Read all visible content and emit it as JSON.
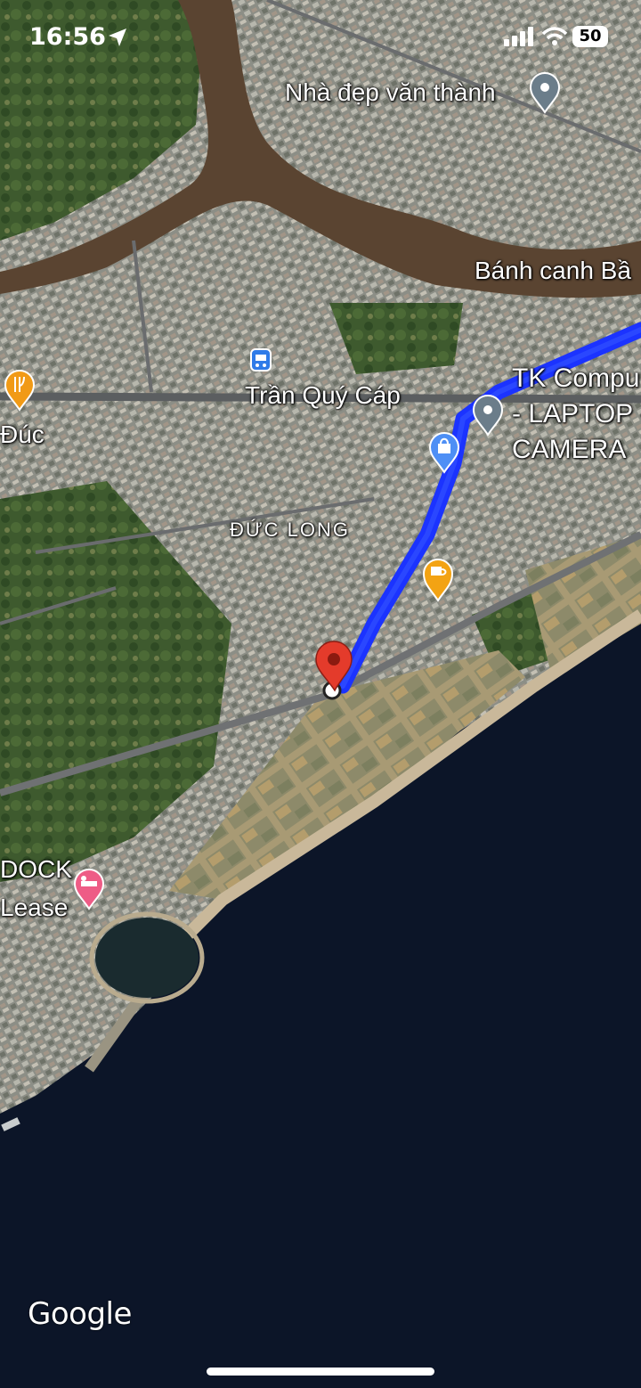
{
  "status_bar": {
    "time": "16:56",
    "battery": "50",
    "icons": [
      "location-arrow-icon",
      "signal-icon",
      "wifi-icon",
      "battery-icon"
    ]
  },
  "map": {
    "type": "satellite",
    "route_color": "#1a3cff",
    "labels": {
      "place_1": "Nhà đẹp văn thành",
      "place_2": "Bánh canh Bầ",
      "street_1": "Trần Quý Cáp",
      "shop_line_1": "TK Compu",
      "shop_line_2": "- LAPTOP -",
      "shop_line_3": "CAMERA",
      "district": "ĐỨC LONG",
      "partial_left": "Đúc",
      "hotel_line_1": "DOCK",
      "hotel_line_2": "Lease"
    },
    "markers": [
      "destination-pin-icon",
      "restaurant-pin-icon",
      "bus-stop-icon",
      "shop-bag-pin-icon",
      "cafe-pin-icon",
      "hotel-pin-icon",
      "place-pin-icon"
    ]
  },
  "branding": {
    "logo": "Google"
  }
}
